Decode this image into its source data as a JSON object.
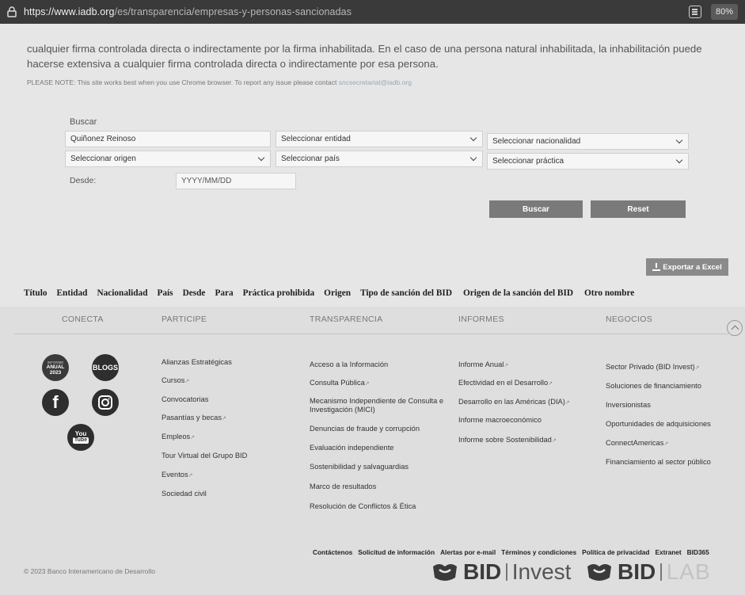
{
  "browser": {
    "url_host": "https://www.iadb.org",
    "url_path": "/es/transparencia/empresas-y-personas-sancionadas",
    "zoom": "80%",
    "reader_icon": "reader-icon",
    "lock_icon": "lock-icon"
  },
  "intro": {
    "text": "cualquier firma controlada directa o indirectamente por la firma inhabilitada. En el caso de una persona natural inhabilitada, la inhabilitación puede hacerse extensiva a cualquier firma controlada directa o indirectamente por esa persona.",
    "note": "PLEASE NOTE: This site works best when you use Chrome browser. To report any issue please contact",
    "note_email": "sncsecretariat@iadb.org"
  },
  "search": {
    "label": "Buscar",
    "query": "Quiñonez Reinoso",
    "entidad": "Seleccionar entidad",
    "nacionalidad": "Seleccionar nacionalidad",
    "origen": "Seleccionar origen",
    "pais": "Seleccionar país",
    "practica": "Seleccionar práctica",
    "desde_label": "Desde:",
    "desde_placeholder": "YYYY/MM/DD",
    "buscar_button": "Buscar",
    "reset_button": "Reset",
    "export_button": "Exportar a Excel"
  },
  "table": {
    "columns": [
      "Título",
      "Entidad",
      "Nacionalidad",
      "País",
      "Desde",
      "Para",
      "Práctica prohibida",
      "Origen",
      "Tipo de sanción del BID",
      "Origen de la sanción del BID",
      "Otro nombre"
    ]
  },
  "footer": {
    "connect_title": "CONECTA",
    "participe_title": "PARTICIPE",
    "transparencia_title": "TRANSPARENCIA",
    "informes_title": "INFORMES",
    "negocios_title": "NEGOCIOS",
    "social": {
      "annual_line1": "INFORME",
      "annual_line2": "ANUAL",
      "annual_year": "2023",
      "blogs": "BLOGS",
      "facebook": "f",
      "youtube_line1": "You",
      "youtube_line2": "Tube"
    },
    "participe": [
      "Alianzas Estratégicas",
      "Cursos",
      "Convocatorias",
      "Pasantías y becas",
      "Empleos",
      "Tour Virtual del Grupo BID",
      "Eventos",
      "Sociedad civil"
    ],
    "transparencia": [
      "Acceso a la Información",
      "Consulta Pública",
      "Mecanismo Independiente de Consulta e Investigación (MICI)",
      "Denuncias de fraude y corrupción",
      "Evaluación independiente",
      "Sostenibilidad y salvaguardias",
      "Marco de resultados",
      "Resolución de Conflictos & Ética"
    ],
    "informes": [
      "Informe Anual",
      "Efectividad en el Desarrollo",
      "Desarrollo en las Américas (DIA)",
      "Informe macroeconómico",
      "Informe sobre Sostenibilidad"
    ],
    "negocios": [
      "Sector Privado (BID Invest)",
      "Soluciones de financiamiento",
      "Inversionistas",
      "Oportunidades de adquisiciones",
      "ConnectAmericas",
      "Financiamiento al sector público"
    ],
    "bottom_links": [
      "Contáctenos",
      "Solicitud de información",
      "Alertas por e-mail",
      "Términos y condiciones",
      "Política de privacidad",
      "Extranet",
      "BID365"
    ],
    "copyright": "© 2023 Banco Interamericano de Desarrollo",
    "logo1_main": "BID",
    "logo1_sub": "Invest",
    "logo2_main": "BID",
    "logo2_sub": "LAB"
  }
}
